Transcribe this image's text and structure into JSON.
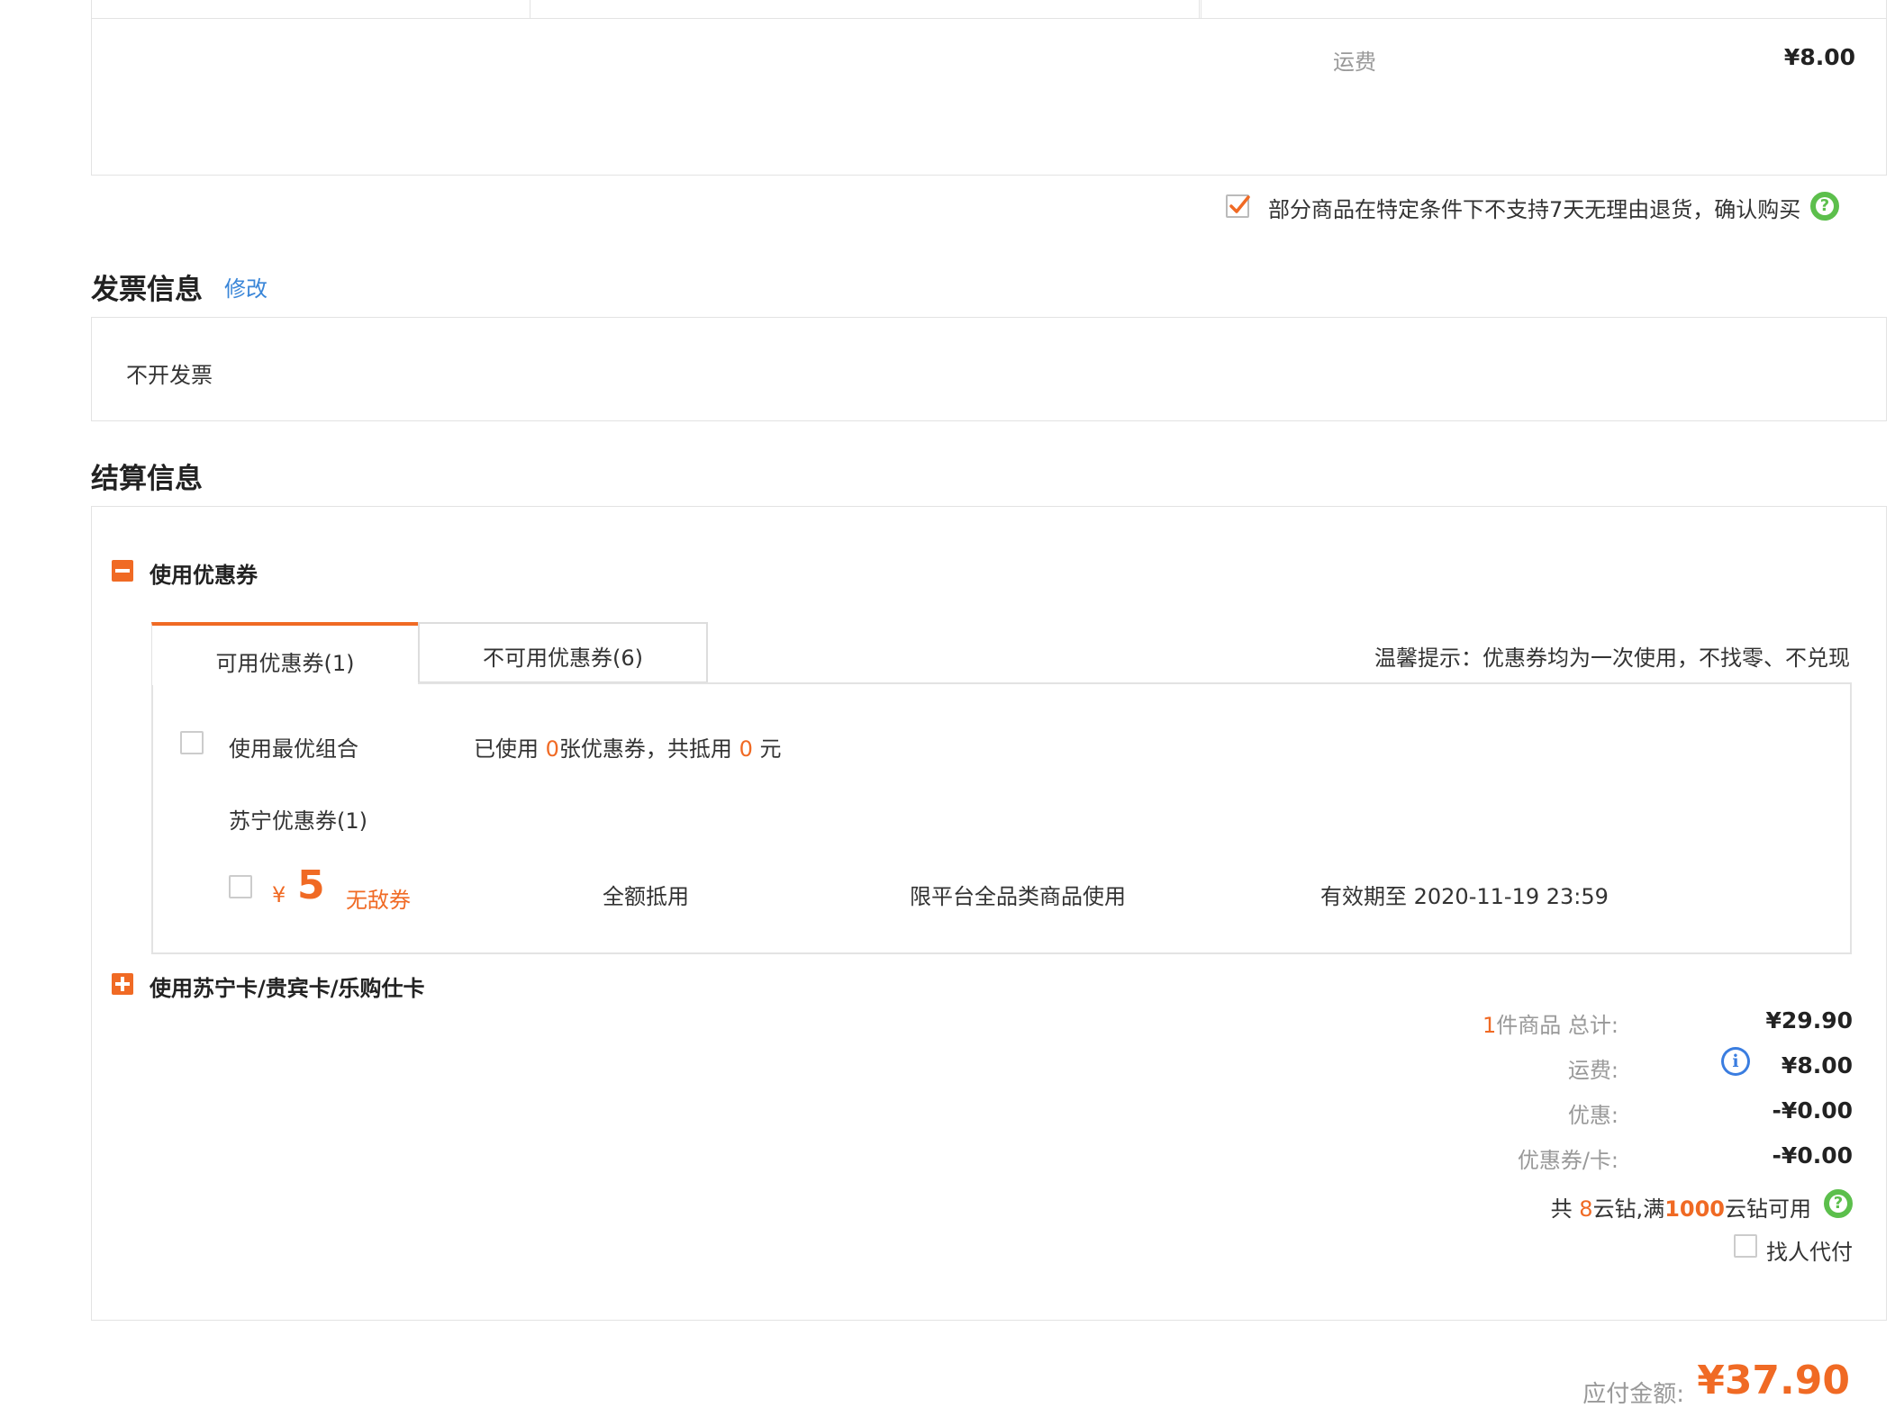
{
  "top_table": {
    "shipping_label": "运费",
    "shipping_value": "¥8.00"
  },
  "return_notice": {
    "checked": true,
    "text": "部分商品在特定条件下不支持7天无理由退货，确认购买",
    "help_icon": "question-circle-icon"
  },
  "invoice": {
    "title": "发票信息",
    "edit_link": "修改",
    "value": "不开发票"
  },
  "settlement": {
    "title": "结算信息",
    "coupon_section": {
      "toggle_icon": "minus-square-icon",
      "label": "使用优惠券",
      "tabs": [
        {
          "label": "可用优惠券(1)",
          "active": true
        },
        {
          "label": "不可用优惠券(6)",
          "active": false
        }
      ],
      "tip": "温馨提示：优惠券均为一次使用，不找零、不兑现",
      "best_combo": {
        "label": "使用最优组合",
        "used_prefix": "已使用",
        "used_count": "0",
        "used_mid": "张优惠券，共抵用",
        "used_amount": "0",
        "used_suffix": "元"
      },
      "group_title": "苏宁优惠券(1)",
      "coupons": [
        {
          "currency": "¥",
          "amount": "5",
          "type": "无敌券",
          "usage": "全额抵用",
          "scope": "限平台全品类商品使用",
          "expiry": "有效期至 2020-11-19 23:59"
        }
      ]
    },
    "card_section": {
      "toggle_icon": "plus-square-icon",
      "label": "使用苏宁卡/贵宾卡/乐购仕卡"
    },
    "summary": {
      "items_count": "1",
      "items_label": "件商品 总计:",
      "items_total": "¥29.90",
      "shipping_label": "运费:",
      "shipping_icon": "info-circle-icon",
      "shipping_value": "¥8.00",
      "discount_label": "优惠:",
      "discount_value": "-¥0.00",
      "coupon_label": "优惠券/卡:",
      "coupon_value": "-¥0.00",
      "yunzuan_prefix": "共",
      "yunzuan_count": "8",
      "yunzuan_mid": "云钻,满",
      "yunzuan_threshold": "1000",
      "yunzuan_suffix": "云钻可用",
      "proxy_pay_label": "找人代付"
    }
  },
  "payable": {
    "label": "应付金额:",
    "value": "¥37.90"
  },
  "colors": {
    "accent": "#f06a24",
    "link": "#3a86d8",
    "help_green": "#5cbf4c",
    "info_blue": "#3a7de0",
    "border": "#e3e3e3"
  }
}
